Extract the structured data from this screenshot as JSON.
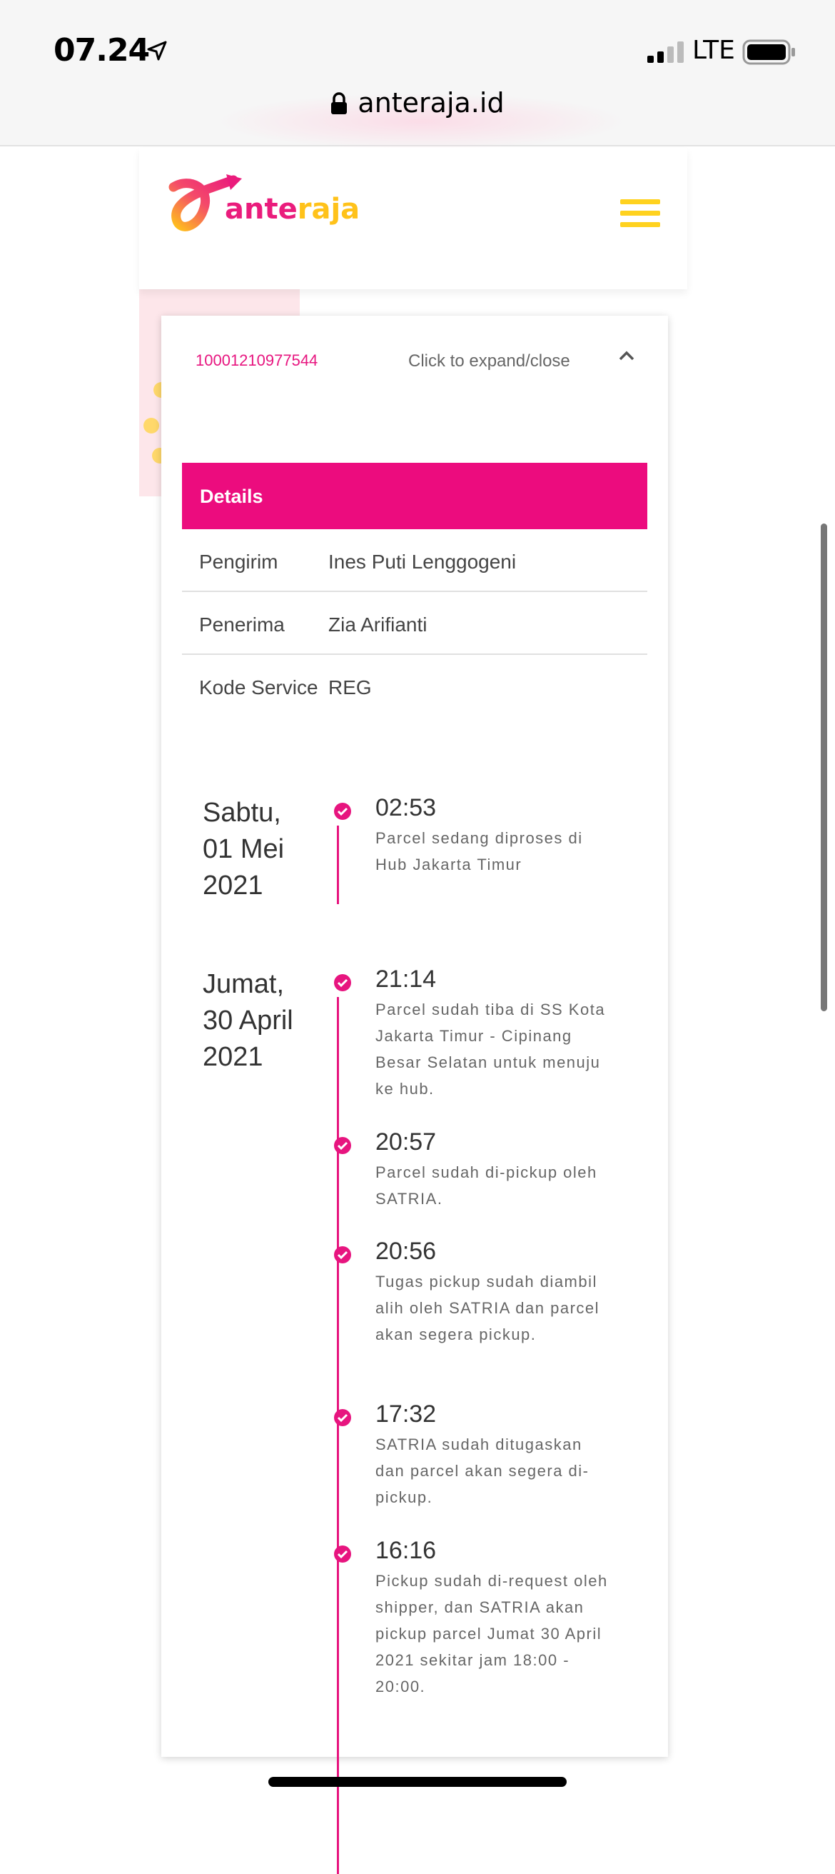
{
  "status_bar": {
    "time": "07.24",
    "network": "LTE"
  },
  "browser": {
    "url": "anteraja.id"
  },
  "brand": {
    "name_part1": "ante",
    "name_part2": "raja",
    "primary_color": "#ec0c7e",
    "accent_color": "#ffd21f"
  },
  "tracking": {
    "awb": "10001210977544",
    "expand_label": "Click to expand/close"
  },
  "details": {
    "heading": "Details",
    "rows": [
      {
        "label": "Pengirim",
        "value": "Ines Puti Lenggogeni"
      },
      {
        "label": "Penerima",
        "value": "Zia Arifianti"
      },
      {
        "label": "Kode Service",
        "value": "REG"
      }
    ]
  },
  "timeline": {
    "days": [
      {
        "date": "Sabtu, 01 Mei 2021"
      },
      {
        "date": "Jumat, 30 April 2021"
      }
    ],
    "events": [
      {
        "time": "02:53",
        "desc": "Parcel sedang diproses di Hub Jakarta Timur"
      },
      {
        "time": "21:14",
        "desc": "Parcel sudah tiba di SS Kota Jakarta Timur - Cipinang Besar Selatan untuk menuju ke hub."
      },
      {
        "time": "20:57",
        "desc": "Parcel sudah di-pickup oleh SATRIA."
      },
      {
        "time": "20:56",
        "desc": "Tugas pickup sudah diambil alih oleh SATRIA dan parcel akan segera pickup."
      },
      {
        "time": "17:32",
        "desc": "SATRIA sudah ditugaskan dan parcel akan segera di-pickup."
      },
      {
        "time": "16:16",
        "desc": "Pickup sudah di-request oleh shipper, dan SATRIA akan pickup parcel Jumat 30 April 2021 sekitar jam 18:00 - 20:00."
      }
    ]
  }
}
